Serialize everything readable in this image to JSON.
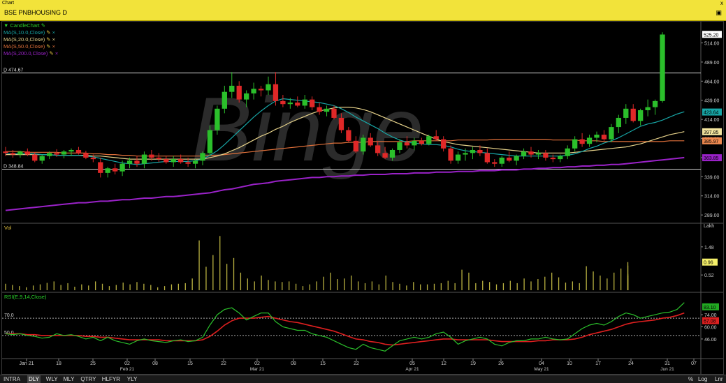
{
  "window": {
    "title": "Chart",
    "close_label": "x"
  },
  "symbol": {
    "name": "BSE PNBHOUSING D"
  },
  "watermark": "Binge",
  "price_panel": {
    "chart_label": "CandleChart",
    "ma_items": [
      {
        "label": "MA(S,10.0,Close)",
        "color": "#17a6a6"
      },
      {
        "label": "MA(S,20.0,Close)",
        "color": "#e6d28a"
      },
      {
        "label": "MA(S,50.0,Close)",
        "color": "#e0703a"
      },
      {
        "label": "MA(S,200.0,Close)",
        "color": "#9a22c8"
      }
    ],
    "resistance": {
      "label": "D 474.67",
      "value": 474.67
    },
    "support": {
      "label": "D 348.84",
      "value": 348.84
    },
    "ticks": [
      "514.00",
      "489.00",
      "464.00",
      "439.00",
      "414.00",
      "389.00",
      "364.00",
      "339.00",
      "314.00",
      "289.00"
    ],
    "tick_values": [
      514,
      489,
      464,
      439,
      414,
      389,
      364,
      339,
      314,
      289
    ],
    "value_boxes": [
      {
        "text": "525.20",
        "value": 525.2,
        "bg": "#ffffff"
      },
      {
        "text": "423.64",
        "value": 423.64,
        "bg": "#17a6a6"
      },
      {
        "text": "397.85",
        "value": 397.85,
        "bg": "#f5e6a0"
      },
      {
        "text": "385.97",
        "value": 385.97,
        "bg": "#f08a50"
      },
      {
        "text": "363.85",
        "value": 363.85,
        "bg": "#9a22c8"
      }
    ]
  },
  "volume_panel": {
    "label": "Vol",
    "ticks": [
      "1.48",
      "0.52"
    ],
    "tick_values": [
      1.48,
      0.52
    ],
    "top_label": "Lakh",
    "value_box": {
      "text": "0.96",
      "value": 0.96
    }
  },
  "rsi_panel": {
    "label": "RSI(E,9,14,Close)",
    "left_labels": [
      "70.0",
      "50.0"
    ],
    "ticks": [
      "74.00",
      "60.00",
      "46.00"
    ],
    "tick_values": [
      74,
      60,
      46
    ],
    "value_boxes": [
      {
        "text": "83.10",
        "value": 83.1,
        "bg": "#22aa22"
      },
      {
        "text": "67.08",
        "value": 67.08,
        "bg": "#dd2020"
      }
    ]
  },
  "x_axis": {
    "labels": [
      "Jan 21",
      "18",
      "25",
      "02",
      "08",
      "15",
      "22",
      "02",
      "08",
      "15",
      "22",
      "05",
      "12",
      "19",
      "26",
      "04",
      "10",
      "17",
      "24",
      "31",
      "07"
    ],
    "sub_labels": [
      "",
      "",
      "",
      "Feb 21",
      "",
      "",
      "",
      "Mar 21",
      "",
      "",
      "",
      "Apr 21",
      "",
      "",
      "",
      "May 21",
      "",
      "",
      "",
      "Jun 21",
      ""
    ]
  },
  "timeframes": [
    "INTRA",
    "DLY",
    "WLY",
    "MLY",
    "QTRY",
    "HLFYR",
    "YLY"
  ],
  "selected_timeframe": "DLY",
  "scale_buttons": [
    "%",
    "Log",
    "Lnr"
  ],
  "chart_data": {
    "type": "candlestick",
    "y_range": [
      280,
      530
    ],
    "candles": [
      [
        372,
        378,
        366,
        370
      ],
      [
        370,
        374,
        364,
        368
      ],
      [
        368,
        373,
        364,
        372
      ],
      [
        372,
        376,
        366,
        368
      ],
      [
        368,
        371,
        358,
        360
      ],
      [
        360,
        368,
        356,
        366
      ],
      [
        366,
        372,
        362,
        370
      ],
      [
        370,
        375,
        365,
        368
      ],
      [
        368,
        374,
        363,
        372
      ],
      [
        372,
        376,
        366,
        374
      ],
      [
        374,
        378,
        368,
        370
      ],
      [
        370,
        373,
        362,
        364
      ],
      [
        364,
        368,
        358,
        362
      ],
      [
        358,
        364,
        338,
        344
      ],
      [
        344,
        352,
        338,
        350
      ],
      [
        350,
        356,
        342,
        346
      ],
      [
        346,
        360,
        340,
        356
      ],
      [
        356,
        364,
        350,
        360
      ],
      [
        360,
        366,
        352,
        356
      ],
      [
        356,
        372,
        350,
        368
      ],
      [
        368,
        374,
        360,
        364
      ],
      [
        364,
        370,
        358,
        362
      ],
      [
        362,
        366,
        356,
        358
      ],
      [
        358,
        366,
        352,
        362
      ],
      [
        362,
        368,
        356,
        358
      ],
      [
        358,
        364,
        352,
        356
      ],
      [
        356,
        362,
        350,
        360
      ],
      [
        360,
        372,
        354,
        370
      ],
      [
        370,
        406,
        366,
        400
      ],
      [
        400,
        432,
        394,
        428
      ],
      [
        428,
        458,
        422,
        450
      ],
      [
        450,
        476,
        442,
        458
      ],
      [
        458,
        464,
        436,
        440
      ],
      [
        440,
        452,
        430,
        448
      ],
      [
        448,
        462,
        440,
        454
      ],
      [
        454,
        458,
        444,
        452
      ],
      [
        452,
        470,
        446,
        460
      ],
      [
        460,
        476,
        432,
        438
      ],
      [
        438,
        446,
        430,
        434
      ],
      [
        434,
        442,
        428,
        436
      ],
      [
        436,
        444,
        430,
        432
      ],
      [
        432,
        446,
        428,
        440
      ],
      [
        440,
        444,
        426,
        430
      ],
      [
        430,
        436,
        420,
        424
      ],
      [
        424,
        432,
        418,
        428
      ],
      [
        428,
        432,
        414,
        416
      ],
      [
        416,
        422,
        396,
        400
      ],
      [
        400,
        404,
        384,
        386
      ],
      [
        386,
        392,
        370,
        372
      ],
      [
        372,
        394,
        368,
        390
      ],
      [
        390,
        396,
        378,
        380
      ],
      [
        380,
        386,
        366,
        370
      ],
      [
        370,
        378,
        362,
        364
      ],
      [
        364,
        376,
        360,
        374
      ],
      [
        374,
        388,
        370,
        384
      ],
      [
        384,
        392,
        376,
        380
      ],
      [
        380,
        390,
        374,
        386
      ],
      [
        386,
        390,
        380,
        382
      ],
      [
        382,
        394,
        380,
        392
      ],
      [
        392,
        400,
        386,
        388
      ],
      [
        388,
        392,
        372,
        376
      ],
      [
        376,
        380,
        356,
        360
      ],
      [
        360,
        372,
        356,
        368
      ],
      [
        368,
        376,
        360,
        370
      ],
      [
        370,
        378,
        362,
        374
      ],
      [
        374,
        380,
        366,
        370
      ],
      [
        370,
        376,
        356,
        358
      ],
      [
        358,
        362,
        352,
        356
      ],
      [
        356,
        366,
        352,
        364
      ],
      [
        364,
        372,
        358,
        360
      ],
      [
        360,
        368,
        354,
        366
      ],
      [
        366,
        376,
        362,
        372
      ],
      [
        372,
        378,
        364,
        368
      ],
      [
        368,
        374,
        362,
        370
      ],
      [
        370,
        374,
        360,
        364
      ],
      [
        364,
        368,
        358,
        362
      ],
      [
        362,
        368,
        358,
        366
      ],
      [
        366,
        380,
        362,
        376
      ],
      [
        376,
        392,
        372,
        388
      ],
      [
        388,
        396,
        378,
        382
      ],
      [
        382,
        394,
        378,
        390
      ],
      [
        390,
        398,
        384,
        394
      ],
      [
        394,
        400,
        386,
        388
      ],
      [
        388,
        408,
        384,
        404
      ],
      [
        404,
        420,
        396,
        416
      ],
      [
        416,
        434,
        408,
        428
      ],
      [
        428,
        434,
        410,
        412
      ],
      [
        412,
        428,
        406,
        426
      ],
      [
        426,
        440,
        418,
        430
      ],
      [
        430,
        440,
        420,
        438
      ],
      [
        438,
        528,
        436,
        525
      ]
    ],
    "volume": [
      0.22,
      0.18,
      0.14,
      0.1,
      0.16,
      0.2,
      0.25,
      0.3,
      0.18,
      0.24,
      0.12,
      0.2,
      0.16,
      0.3,
      0.22,
      0.14,
      0.18,
      0.26,
      0.2,
      0.28,
      0.22,
      0.18,
      0.1,
      0.14,
      0.2,
      0.22,
      0.24,
      0.4,
      1.7,
      0.8,
      1.2,
      1.85,
      0.9,
      1.1,
      0.6,
      0.4,
      0.3,
      0.5,
      0.35,
      0.3,
      0.28,
      0.3,
      0.22,
      0.14,
      0.2,
      0.3,
      0.46,
      0.6,
      0.38,
      0.4,
      0.5,
      0.3,
      0.24,
      0.3,
      0.2,
      0.5,
      0.28,
      0.22,
      0.16,
      0.28,
      0.2,
      0.2,
      0.22,
      0.24,
      0.32,
      0.24,
      0.7,
      0.6,
      0.24,
      0.32,
      0.28,
      0.2,
      0.24,
      0.32,
      0.24,
      0.4,
      0.3,
      0.38,
      0.46,
      0.6,
      0.44,
      0.26,
      0.3,
      0.24,
      0.82,
      0.64,
      0.5,
      0.4,
      0.6,
      0.74,
      0.5,
      0.84,
      0.5,
      0.4,
      0.56,
      0.96
    ],
    "ma10": [
      370,
      369,
      369,
      369,
      369,
      368,
      368,
      367,
      367,
      367,
      367,
      366,
      365,
      363,
      361,
      359,
      357,
      356,
      355,
      356,
      357,
      358,
      359,
      359,
      359,
      359,
      360,
      362,
      367,
      373,
      381,
      390,
      399,
      408,
      417,
      425,
      432,
      438,
      441,
      440,
      439,
      438,
      437,
      436,
      434,
      432,
      428,
      423,
      417,
      412,
      407,
      402,
      396,
      391,
      387,
      384,
      383,
      382,
      381,
      381,
      380,
      378,
      375,
      373,
      372,
      371,
      370,
      369,
      368,
      367,
      366,
      366,
      366,
      366,
      366,
      366,
      366,
      367,
      369,
      372,
      376,
      379,
      383,
      386,
      390,
      395,
      400,
      405,
      408,
      410,
      413,
      417,
      421,
      424
    ],
    "ma20": [
      368,
      368,
      368,
      368,
      368,
      368,
      368,
      367,
      367,
      367,
      367,
      367,
      366,
      366,
      365,
      364,
      363,
      362,
      362,
      362,
      362,
      362,
      362,
      362,
      362,
      362,
      362,
      362,
      364,
      366,
      369,
      373,
      377,
      382,
      387,
      392,
      396,
      401,
      405,
      410,
      414,
      418,
      422,
      425,
      427,
      429,
      430,
      430,
      429,
      427,
      424,
      420,
      416,
      412,
      408,
      404,
      400,
      396,
      392,
      388,
      385,
      383,
      381,
      380,
      379,
      378,
      377,
      376,
      375,
      374,
      373,
      372,
      371,
      370,
      370,
      370,
      370,
      370,
      371,
      372,
      373,
      374,
      375,
      376,
      377,
      378,
      380,
      382,
      385,
      388,
      391,
      394,
      396,
      398
    ],
    "ma50": [
      372,
      372,
      372,
      371,
      371,
      371,
      371,
      371,
      370,
      370,
      370,
      370,
      369,
      369,
      368,
      368,
      367,
      367,
      366,
      366,
      366,
      366,
      366,
      366,
      366,
      366,
      366,
      366,
      367,
      367,
      368,
      369,
      370,
      371,
      372,
      373,
      374,
      375,
      376,
      377,
      378,
      379,
      380,
      381,
      382,
      383,
      383,
      384,
      384,
      384,
      385,
      385,
      385,
      385,
      385,
      385,
      386,
      386,
      386,
      386,
      386,
      386,
      387,
      387,
      387,
      387,
      387,
      388,
      388,
      388,
      388,
      388,
      388,
      388,
      388,
      387,
      387,
      387,
      387,
      386,
      386,
      386,
      385,
      385,
      385,
      385,
      385,
      385,
      385,
      385,
      385,
      386,
      386,
      386
    ],
    "ma200": [
      295,
      296,
      297,
      298,
      299,
      300,
      301,
      302,
      303,
      304,
      305,
      305,
      306,
      307,
      307,
      308,
      309,
      309,
      310,
      311,
      311,
      312,
      313,
      313,
      314,
      315,
      316,
      317,
      318,
      320,
      322,
      323,
      325,
      327,
      329,
      330,
      331,
      333,
      334,
      335,
      336,
      337,
      338,
      338,
      339,
      339,
      340,
      340,
      341,
      341,
      342,
      342,
      342,
      343,
      343,
      343,
      344,
      344,
      344,
      345,
      345,
      345,
      346,
      346,
      346,
      347,
      347,
      347,
      348,
      348,
      348,
      349,
      349,
      350,
      350,
      351,
      351,
      352,
      352,
      353,
      353,
      354,
      354,
      355,
      355,
      356,
      357,
      358,
      359,
      360,
      361,
      362,
      363,
      364
    ],
    "rsi": [
      52,
      51,
      52,
      50,
      49,
      47,
      48,
      52,
      50,
      51,
      49,
      46,
      48,
      44,
      48,
      44,
      42,
      40,
      44,
      46,
      44,
      43,
      42,
      44,
      45,
      43,
      44,
      48,
      62,
      74,
      80,
      82,
      76,
      68,
      72,
      76,
      76,
      66,
      60,
      58,
      56,
      56,
      52,
      50,
      48,
      44,
      40,
      36,
      34,
      40,
      36,
      34,
      32,
      38,
      44,
      46,
      48,
      46,
      48,
      52,
      54,
      48,
      40,
      44,
      46,
      48,
      46,
      40,
      38,
      42,
      44,
      44,
      46,
      46,
      48,
      46,
      45,
      46,
      52,
      58,
      62,
      64,
      62,
      66,
      72,
      76,
      74,
      70,
      72,
      74,
      76,
      77,
      80,
      88
    ],
    "rsi_signal": [
      52,
      52,
      52,
      51,
      51,
      50,
      50,
      50,
      50,
      50,
      50,
      49,
      49,
      48,
      48,
      47,
      46,
      45,
      45,
      45,
      45,
      45,
      44,
      44,
      44,
      44,
      44,
      45,
      49,
      55,
      62,
      67,
      70,
      70,
      70,
      71,
      72,
      70,
      68,
      66,
      65,
      63,
      61,
      59,
      57,
      55,
      52,
      49,
      46,
      45,
      43,
      42,
      40,
      39,
      40,
      41,
      42,
      43,
      44,
      45,
      46,
      46,
      45,
      45,
      45,
      45,
      45,
      44,
      43,
      43,
      43,
      43,
      43,
      44,
      44,
      45,
      45,
      45,
      46,
      48,
      51,
      53,
      55,
      57,
      60,
      63,
      65,
      66,
      67,
      68,
      70,
      71,
      73,
      76
    ]
  }
}
